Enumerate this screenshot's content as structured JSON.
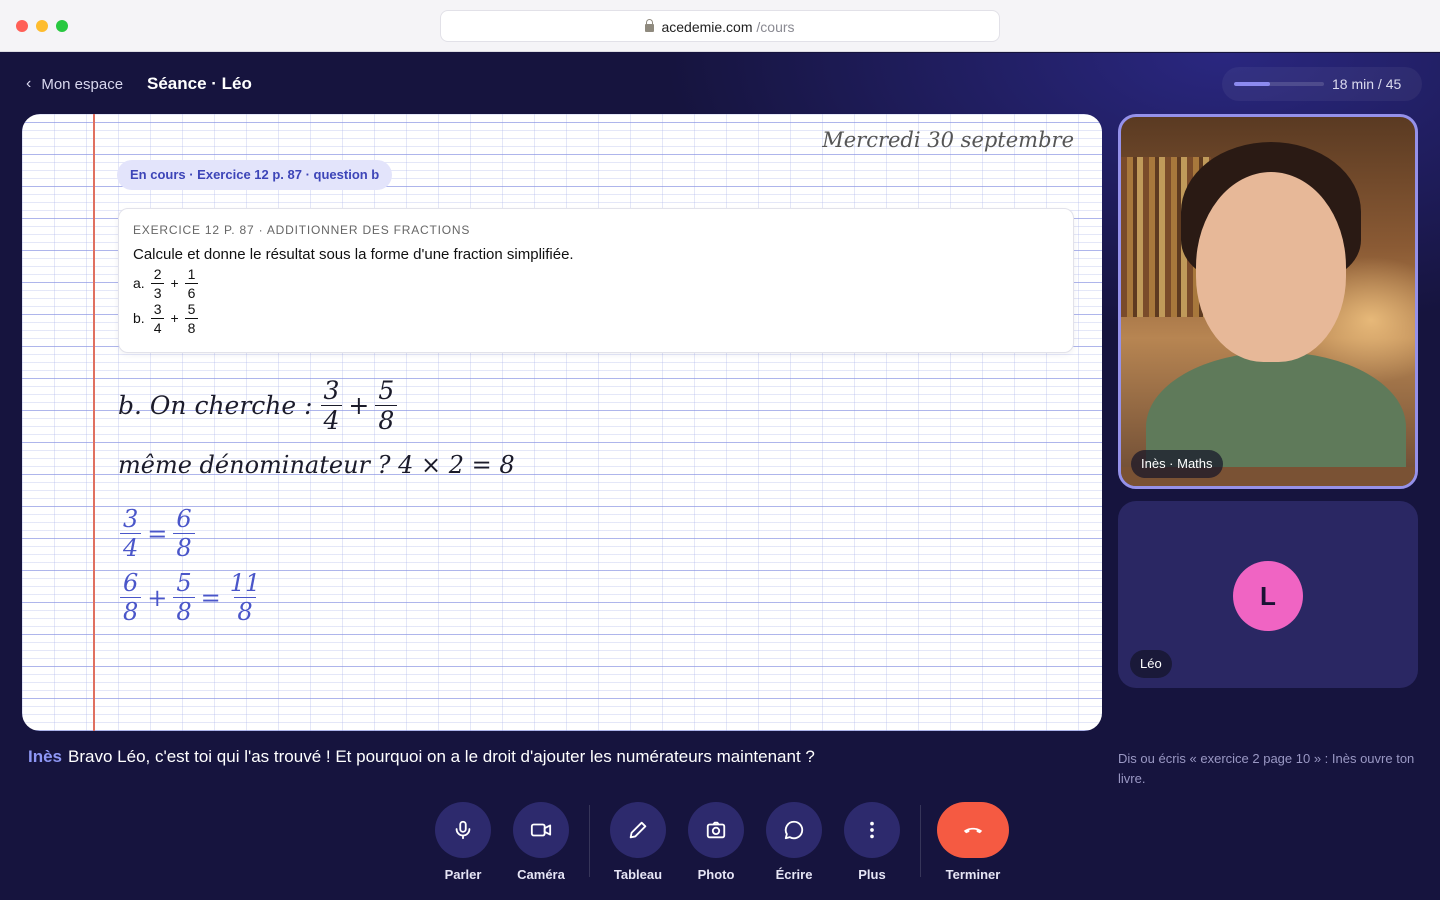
{
  "browser": {
    "domain": "acedemie.com",
    "path": "/cours"
  },
  "header": {
    "back_label": "Mon espace",
    "title": "Séance · Léo",
    "timer": "18 min / 45",
    "progress_fraction": 0.4
  },
  "board": {
    "date": "Mercredi 30 septembre",
    "status": "En cours · Exercice 12 p. 87 · question b",
    "exercise": {
      "heading": "EXERCICE 12 P. 87 · ADDITIONNER DES FRACTIONS",
      "question": "Calcule et donne le résultat sous la forme d'une fraction simplifiée.",
      "items": [
        {
          "label": "a.",
          "f1": [
            "2",
            "3"
          ],
          "op": "+",
          "f2": [
            "1",
            "6"
          ]
        },
        {
          "label": "b.",
          "f1": [
            "3",
            "4"
          ],
          "op": "+",
          "f2": [
            "5",
            "8"
          ]
        }
      ]
    },
    "handwriting": {
      "line1_text": "b. On cherche :",
      "line1_f1": [
        "3",
        "4"
      ],
      "line1_op": "+",
      "line1_f2": [
        "5",
        "8"
      ],
      "line2": "même dénominateur ? 4 × 2 = 8",
      "line3_f1": [
        "3",
        "4"
      ],
      "line3_eq": "=",
      "line3_f2": [
        "6",
        "8"
      ],
      "line4_f1": [
        "6",
        "8"
      ],
      "line4_op": "+",
      "line4_f2": [
        "5",
        "8"
      ],
      "line4_eq": "=",
      "line4_f3": [
        "11",
        "8"
      ]
    }
  },
  "video": {
    "teacher_label": "Inès · Maths",
    "student_initial": "L",
    "student_label": "Léo"
  },
  "caption": {
    "speaker": "Inès",
    "text": "Bravo Léo, c'est toi qui l'as trouvé ! Et pourquoi on a le droit d'ajouter les numérateurs maintenant ?"
  },
  "hint": "Dis ou écris « exercice 2 page 10 » : Inès ouvre ton livre.",
  "controls": [
    {
      "label": "Parler",
      "icon": "mic-icon"
    },
    {
      "label": "Caméra",
      "icon": "camera-icon"
    },
    {
      "label": "Tableau",
      "icon": "pencil-icon"
    },
    {
      "label": "Photo",
      "icon": "photo-icon"
    },
    {
      "label": "Écrire",
      "icon": "chat-icon"
    },
    {
      "label": "Plus",
      "icon": "more-icon"
    },
    {
      "label": "Terminer",
      "icon": "hangup-icon"
    }
  ],
  "colors": {
    "accent": "#8e97f5",
    "end_call": "#f55a42",
    "avatar": "#f064c3"
  }
}
